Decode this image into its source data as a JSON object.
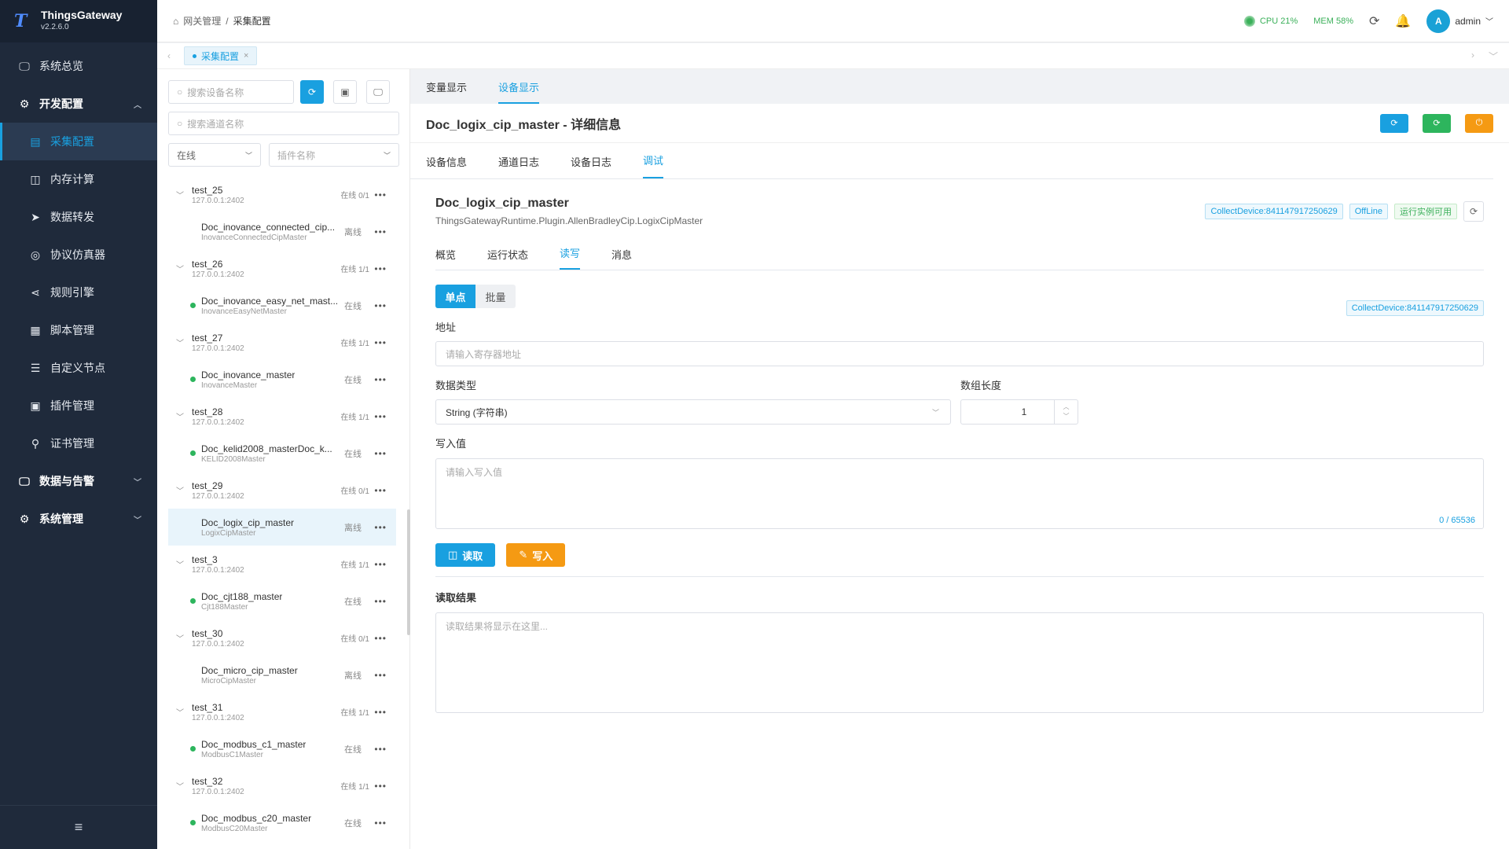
{
  "brand": {
    "logo": "T",
    "name": "ThingsGateway",
    "version": "v2.2.6.0"
  },
  "sidebar": {
    "items": [
      {
        "label": "系统总览",
        "icon": "monitor-icon",
        "glyph": "🖵",
        "level": "top",
        "active": false
      },
      {
        "label": "开发配置",
        "icon": "gear-icon",
        "glyph": "⚙",
        "level": "top",
        "active": false,
        "bold": true,
        "arrow": "︿"
      },
      {
        "label": "采集配置",
        "icon": "collect-icon",
        "glyph": "▤",
        "level": "sub",
        "active": true
      },
      {
        "label": "内存计算",
        "icon": "chip-icon",
        "glyph": "◫",
        "level": "sub",
        "active": false
      },
      {
        "label": "数据转发",
        "icon": "send-icon",
        "glyph": "➤",
        "level": "sub",
        "active": false
      },
      {
        "label": "协议仿真器",
        "icon": "simulator-icon",
        "glyph": "◎",
        "level": "sub",
        "active": false
      },
      {
        "label": "规则引擎",
        "icon": "share-icon",
        "glyph": "⋖",
        "level": "sub",
        "active": false
      },
      {
        "label": "脚本管理",
        "icon": "script-icon",
        "glyph": "▦",
        "level": "sub",
        "active": false
      },
      {
        "label": "自定义节点",
        "icon": "sliders-icon",
        "glyph": "☰",
        "level": "sub",
        "active": false
      },
      {
        "label": "插件管理",
        "icon": "plugin-icon",
        "glyph": "▣",
        "level": "sub",
        "active": false
      },
      {
        "label": "证书管理",
        "icon": "certificate-icon",
        "glyph": "⚲",
        "level": "sub",
        "active": false
      },
      {
        "label": "数据与告警",
        "icon": "alarm-icon",
        "glyph": "🖵",
        "level": "top",
        "active": false,
        "bold": true,
        "arrow": "﹀"
      },
      {
        "label": "系统管理",
        "icon": "settings-icon",
        "glyph": "⚙",
        "level": "top",
        "active": false,
        "bold": true,
        "arrow": "﹀"
      }
    ],
    "collapse_glyph": "≡"
  },
  "header": {
    "breadcrumb_home": "网关管理",
    "breadcrumb_sep": "/",
    "breadcrumb_current": "采集配置",
    "cpu": "CPU 21%",
    "mem": "MEM 58%",
    "user_initial": "A",
    "user_name": "admin"
  },
  "page_tab": {
    "label": "采集配置",
    "close": "×"
  },
  "device_panel": {
    "search_device_placeholder": "搜索设备名称",
    "search_channel_placeholder": "搜索通道名称",
    "status_select": "在线",
    "plugin_select_placeholder": "插件名称",
    "groups": [
      {
        "name": "test_25",
        "ip": "127.0.0.1:2402",
        "status": "在线 0/1",
        "devices": [
          {
            "name": "Doc_inovance_connected_cip...",
            "plugin": "InovanceConnectedCipMaster",
            "status": "离线",
            "online": false,
            "selected": false
          }
        ]
      },
      {
        "name": "test_26",
        "ip": "127.0.0.1:2402",
        "status": "在线 1/1",
        "devices": [
          {
            "name": "Doc_inovance_easy_net_mast...",
            "plugin": "InovanceEasyNetMaster",
            "status": "在线",
            "online": true,
            "selected": false
          }
        ]
      },
      {
        "name": "test_27",
        "ip": "127.0.0.1:2402",
        "status": "在线 1/1",
        "devices": [
          {
            "name": "Doc_inovance_master",
            "plugin": "InovanceMaster",
            "status": "在线",
            "online": true,
            "selected": false
          }
        ]
      },
      {
        "name": "test_28",
        "ip": "127.0.0.1:2402",
        "status": "在线 1/1",
        "devices": [
          {
            "name": "Doc_kelid2008_masterDoc_k...",
            "plugin": "KELID2008Master",
            "status": "在线",
            "online": true,
            "selected": false
          }
        ]
      },
      {
        "name": "test_29",
        "ip": "127.0.0.1:2402",
        "status": "在线 0/1",
        "devices": [
          {
            "name": "Doc_logix_cip_master",
            "plugin": "LogixCipMaster",
            "status": "离线",
            "online": false,
            "selected": true
          }
        ]
      },
      {
        "name": "test_3",
        "ip": "127.0.0.1:2402",
        "status": "在线 1/1",
        "devices": [
          {
            "name": "Doc_cjt188_master",
            "plugin": "Cjt188Master",
            "status": "在线",
            "online": true,
            "selected": false
          }
        ]
      },
      {
        "name": "test_30",
        "ip": "127.0.0.1:2402",
        "status": "在线 0/1",
        "devices": [
          {
            "name": "Doc_micro_cip_master",
            "plugin": "MicroCipMaster",
            "status": "离线",
            "online": false,
            "selected": false
          }
        ]
      },
      {
        "name": "test_31",
        "ip": "127.0.0.1:2402",
        "status": "在线 1/1",
        "devices": [
          {
            "name": "Doc_modbus_c1_master",
            "plugin": "ModbusC1Master",
            "status": "在线",
            "online": true,
            "selected": false
          }
        ]
      },
      {
        "name": "test_32",
        "ip": "127.0.0.1:2402",
        "status": "在线 1/1",
        "devices": [
          {
            "name": "Doc_modbus_c20_master",
            "plugin": "ModbusC20Master",
            "status": "在线",
            "online": true,
            "selected": false
          }
        ]
      }
    ]
  },
  "main": {
    "view_tabs": [
      "变量显示",
      "设备显示"
    ],
    "view_tab_active": 1,
    "title": "Doc_logix_cip_master - 详细信息",
    "title_buttons": [
      {
        "name": "refresh-button",
        "color": "#19a0e0",
        "glyph": "⟳"
      },
      {
        "name": "restart-button",
        "color": "#2db55d",
        "glyph": "⟳"
      },
      {
        "name": "stop-button",
        "color": "#f59a13",
        "glyph": "⏻"
      }
    ],
    "detail_tabs": [
      "设备信息",
      "通道日志",
      "设备日志",
      "调试"
    ],
    "detail_tab_active": 3,
    "device_name": "Doc_logix_cip_master",
    "device_plugin": "ThingsGatewayRuntime.Plugin.AllenBradleyCip.LogixCipMaster",
    "tags": [
      "CollectDevice:841147917250629",
      "OffLine",
      "运行实例可用"
    ],
    "sub_tabs": [
      "概览",
      "运行状态",
      "读写",
      "消息"
    ],
    "sub_tab_active": 2,
    "mode_single": "单点",
    "mode_batch": "批量",
    "form_tag": "CollectDevice:841147917250629",
    "address_label": "地址",
    "address_placeholder": "请输入寄存器地址",
    "datatype_label": "数据类型",
    "datatype_value": "String (字符串)",
    "array_length_label": "数组长度",
    "array_length_value": "1",
    "write_value_label": "写入值",
    "write_value_placeholder": "请输入写入值",
    "write_value_count": "0 / 65536",
    "read_button": "读取",
    "write_button": "写入",
    "read_result_label": "读取结果",
    "read_result_placeholder": "读取结果将显示在这里..."
  },
  "colors": {
    "accent": "#19a0e0",
    "online": "#2db55d",
    "warning": "#f59a13",
    "sidebar_bg": "#1f2a3b"
  }
}
